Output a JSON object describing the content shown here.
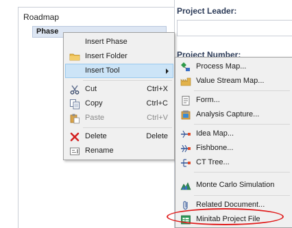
{
  "tree": {
    "title": "Roadmap",
    "phase_label": "Phase"
  },
  "form": {
    "project_leader_label": "Project Leader:",
    "project_leader_value": "",
    "project_number_label": "Project Number:"
  },
  "context_menu": {
    "items": [
      {
        "label": "Insert Phase",
        "shortcut": "",
        "icon": "none"
      },
      {
        "label": "Insert Folder",
        "shortcut": "",
        "icon": "folder-icon"
      },
      {
        "label": "Insert Tool",
        "shortcut": "",
        "icon": "none",
        "submenu": true,
        "highlighted": true
      },
      {
        "label": "Cut",
        "shortcut": "Ctrl+X",
        "icon": "scissors-icon"
      },
      {
        "label": "Copy",
        "shortcut": "Ctrl+C",
        "icon": "copy-icon"
      },
      {
        "label": "Paste",
        "shortcut": "Ctrl+V",
        "icon": "paste-icon",
        "disabled": true
      },
      {
        "label": "Delete",
        "shortcut": "Delete",
        "icon": "delete-x-icon"
      },
      {
        "label": "Rename",
        "shortcut": "",
        "icon": "rename-icon"
      }
    ]
  },
  "submenu": {
    "items": [
      {
        "label": "Process Map...",
        "icon": "process-map-icon"
      },
      {
        "label": "Value Stream Map...",
        "icon": "value-stream-map-icon"
      },
      {
        "label": "Form...",
        "icon": "form-icon"
      },
      {
        "label": "Analysis Capture...",
        "icon": "analysis-capture-icon"
      },
      {
        "label": "Idea Map...",
        "icon": "idea-map-icon"
      },
      {
        "label": "Fishbone...",
        "icon": "fishbone-icon"
      },
      {
        "label": "CT Tree...",
        "icon": "ct-tree-icon"
      },
      {
        "label": "Monte Carlo Simulation",
        "icon": "monte-carlo-icon"
      },
      {
        "label": "Related Document...",
        "icon": "paperclip-icon"
      },
      {
        "label": "Minitab Project File",
        "icon": "minitab-project-icon",
        "annotated": true
      }
    ]
  },
  "colors": {
    "menu_background": "#f0f0f0",
    "menu_highlight": "#cce4f7",
    "annotation_red": "#e01b1b",
    "label_navy": "#2b3a57"
  }
}
